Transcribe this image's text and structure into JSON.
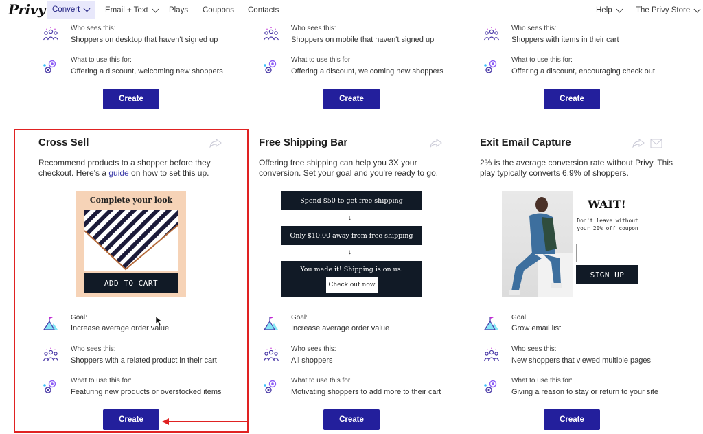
{
  "nav": {
    "logo": "Privy",
    "items": [
      {
        "label": "Convert",
        "active": true,
        "dropdown": true
      },
      {
        "label": "Email + Text",
        "active": false,
        "dropdown": true
      },
      {
        "label": "Plays",
        "active": false,
        "dropdown": false
      },
      {
        "label": "Coupons",
        "active": false,
        "dropdown": false
      },
      {
        "label": "Contacts",
        "active": false,
        "dropdown": false
      }
    ],
    "help": "Help",
    "store": "The Privy Store"
  },
  "top_row": [
    {
      "who_label": "Who sees this:",
      "who_value": "Shoppers on desktop that haven't signed up",
      "use_label": "What to use this for:",
      "use_value": "Offering a discount, welcoming new shoppers",
      "create": "Create"
    },
    {
      "who_label": "Who sees this:",
      "who_value": "Shoppers on mobile that haven't signed up",
      "use_label": "What to use this for:",
      "use_value": "Offering a discount, welcoming new shoppers",
      "create": "Create"
    },
    {
      "who_label": "Who sees this:",
      "who_value": "Shoppers with items in their cart",
      "use_label": "What to use this for:",
      "use_value": "Offering a discount, encouraging check out",
      "create": "Create"
    }
  ],
  "cards": [
    {
      "title": "Cross Sell",
      "desc_pre": "Recommend products to a shopper before they checkout. Here's a ",
      "desc_link": "guide",
      "desc_post": " on how to set this up.",
      "preview": {
        "heading": "Complete your look",
        "button": "ADD TO CART"
      },
      "goal_label": "Goal:",
      "goal_value": "Increase average order value",
      "who_label": "Who sees this:",
      "who_value": "Shoppers with a related product in their cart",
      "use_label": "What to use this for:",
      "use_value": "Featuring new products or overstocked items",
      "create": "Create"
    },
    {
      "title": "Free Shipping Bar",
      "desc": "Offering free shipping can help you 3X your conversion. Set your goal and you're ready to go.",
      "preview": {
        "bar1": "Spend $50 to get free shipping",
        "arrow": "↓",
        "bar2": "Only $10.00 away from free shipping",
        "bar3": "You made it! Shipping is on us.",
        "checkout": "Check out now"
      },
      "goal_label": "Goal:",
      "goal_value": "Increase average order value",
      "who_label": "Who sees this:",
      "who_value": "All shoppers",
      "use_label": "What to use this for:",
      "use_value": "Motivating shoppers to add more to their cart",
      "create": "Create"
    },
    {
      "title": "Exit Email Capture",
      "desc": "2% is the average conversion rate without Privy. This play typically converts 6.9% of shoppers.",
      "preview": {
        "wait": "WAIT!",
        "sub": "Don't leave without your 20% off coupon",
        "button": "SIGN UP"
      },
      "goal_label": "Goal:",
      "goal_value": "Grow email list",
      "who_label": "Who sees this:",
      "who_value": "New shoppers that viewed multiple pages",
      "use_label": "What to use this for:",
      "use_value": "Giving a reason to stay or return to your site",
      "create": "Create"
    }
  ],
  "colors": {
    "primary_button": "#231f9c",
    "highlight": "#e02222",
    "preview_dark": "#111a26",
    "nav_active_bg": "#e8e8fb"
  }
}
